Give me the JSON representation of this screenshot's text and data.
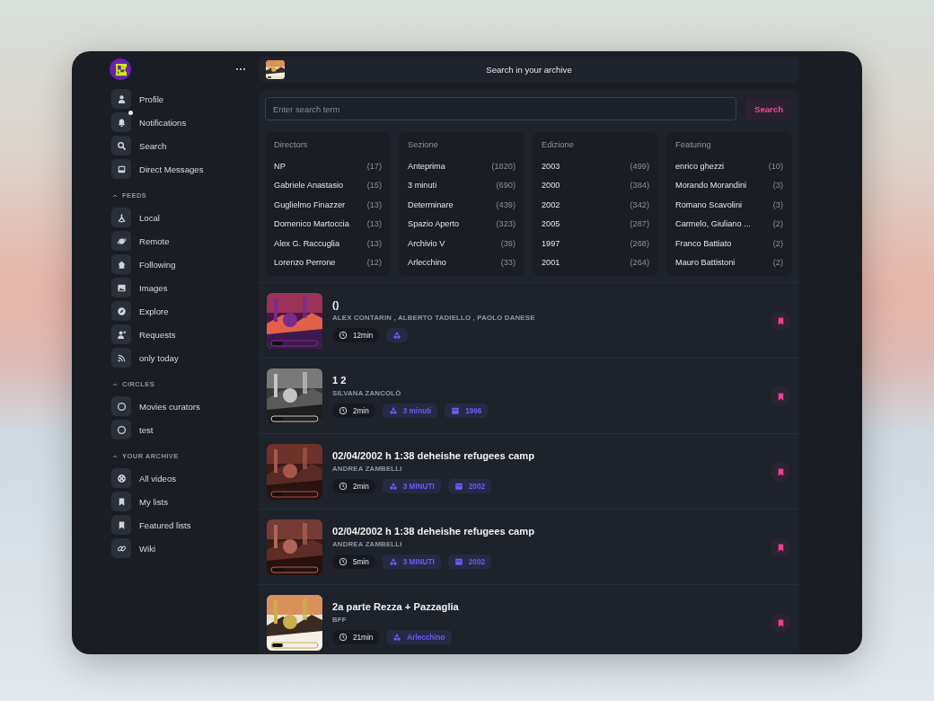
{
  "sidebar": {
    "items": [
      {
        "label": "Profile",
        "unread": false
      },
      {
        "label": "Notifications",
        "unread": true
      },
      {
        "label": "Search",
        "unread": false
      },
      {
        "label": "Direct Messages",
        "unread": false
      }
    ],
    "sections": [
      {
        "title": "FEEDS",
        "expanded": true,
        "items": [
          {
            "label": "Local"
          },
          {
            "label": "Remote"
          },
          {
            "label": "Following"
          },
          {
            "label": "Images"
          },
          {
            "label": "Explore"
          },
          {
            "label": "Requests"
          },
          {
            "label": "only today"
          }
        ]
      },
      {
        "title": "CIRCLES",
        "expanded": true,
        "items": [
          {
            "label": "Movies curators"
          },
          {
            "label": "test"
          }
        ]
      },
      {
        "title": "YOUR ARCHIVE",
        "expanded": true,
        "items": [
          {
            "label": "All videos"
          },
          {
            "label": "My lists"
          },
          {
            "label": "Featured lists"
          },
          {
            "label": "Wiki"
          }
        ]
      }
    ]
  },
  "header": {
    "title": "Search in your archive"
  },
  "search": {
    "placeholder": "Enter search term",
    "button": "Search"
  },
  "facets": [
    {
      "title": "Directors",
      "entries": [
        {
          "label": "NP",
          "count": "(17)"
        },
        {
          "label": "Gabriele Anastasio",
          "count": "(15)"
        },
        {
          "label": "Guglielmo Finazzer",
          "count": "(13)"
        },
        {
          "label": "Domenico Martoccia",
          "count": "(13)"
        },
        {
          "label": "Alex G. Raccuglia",
          "count": "(13)"
        },
        {
          "label": "Lorenzo Perrone",
          "count": "(12)"
        }
      ]
    },
    {
      "title": "Sezione",
      "entries": [
        {
          "label": "Anteprima",
          "count": "(1820)"
        },
        {
          "label": "3 minuti",
          "count": "(690)"
        },
        {
          "label": "Determinare",
          "count": "(439)"
        },
        {
          "label": "Spazio Aperto",
          "count": "(323)"
        },
        {
          "label": "Archivio V",
          "count": "(39)"
        },
        {
          "label": "Arlecchino",
          "count": "(33)"
        }
      ]
    },
    {
      "title": "Edizione",
      "entries": [
        {
          "label": "2003",
          "count": "(499)"
        },
        {
          "label": "2000",
          "count": "(384)"
        },
        {
          "label": "2002",
          "count": "(342)"
        },
        {
          "label": "2005",
          "count": "(287)"
        },
        {
          "label": "1997",
          "count": "(268)"
        },
        {
          "label": "2001",
          "count": "(264)"
        }
      ]
    },
    {
      "title": "Featuring",
      "entries": [
        {
          "label": "enrico ghezzi",
          "count": "(10)"
        },
        {
          "label": "Morando Morandini",
          "count": "(3)"
        },
        {
          "label": "Romano Scavolini",
          "count": "(3)"
        },
        {
          "label": "Carmelo, Giuliano ...",
          "count": "(2)"
        },
        {
          "label": "Franco Battiato",
          "count": "(2)"
        },
        {
          "label": "Mauro Battistoni",
          "count": "(2)"
        }
      ]
    }
  ],
  "videos": [
    {
      "title": "()",
      "authors": "ALEX CONTARIN , ALBERTO TADIELLO , PAOLO DANESE",
      "duration": "12min",
      "bookmarked": true,
      "tags": [
        {
          "kind": "section"
        }
      ]
    },
    {
      "title": "1 2",
      "authors": "SILVANA ZANCOLÒ",
      "duration": "2min",
      "bookmarked": true,
      "tags": [
        {
          "kind": "section",
          "label": "3 minuti"
        },
        {
          "kind": "year",
          "label": "1996"
        }
      ]
    },
    {
      "title": "02/04/2002 h 1:38 deheishe refugees camp",
      "authors": "ANDREA ZAMBELLI",
      "duration": "2min",
      "bookmarked": true,
      "tags": [
        {
          "kind": "section",
          "label": "3 MINUTI"
        },
        {
          "kind": "year",
          "label": "2002"
        }
      ]
    },
    {
      "title": "02/04/2002 h 1:38 deheishe refugees camp",
      "authors": "ANDREA ZAMBELLI",
      "duration": "5min",
      "bookmarked": true,
      "tags": [
        {
          "kind": "section",
          "label": "3 MINUTI"
        },
        {
          "kind": "year",
          "label": "2002"
        }
      ]
    },
    {
      "title": "2a parte Rezza + Pazzaglia",
      "authors": "BFF",
      "duration": "21min",
      "bookmarked": true,
      "tags": [
        {
          "kind": "section",
          "label": "Arlecchino"
        }
      ]
    }
  ]
}
